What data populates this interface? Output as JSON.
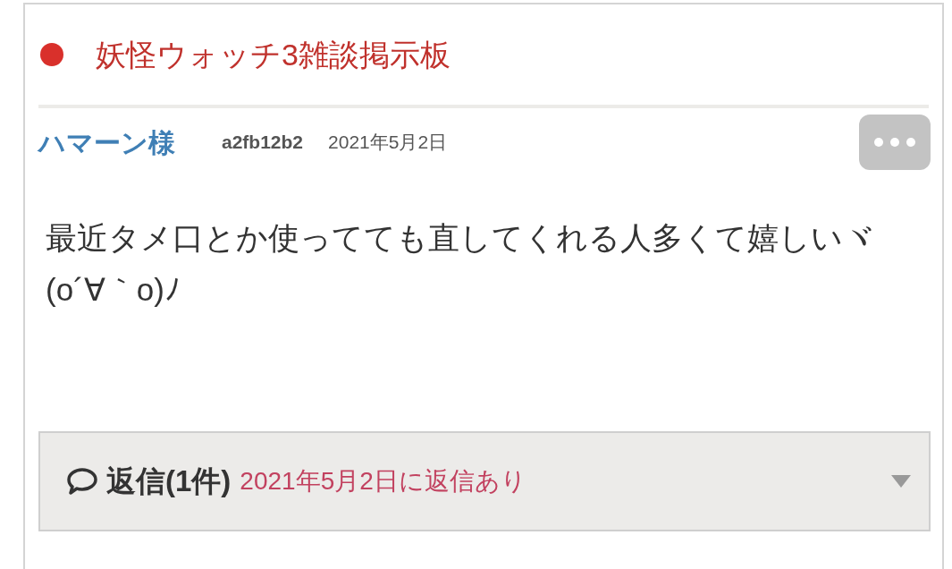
{
  "board": {
    "title": "妖怪ウォッチ3雑談掲示板",
    "color": "#d9302b"
  },
  "post": {
    "author": "ハマーン様",
    "id": "a2fb12b2",
    "date": "2021年5月2日",
    "body": "最近タメ口とか使ってても直してくれる人多くて嬉しいヾ(o´∀｀o)ﾉ"
  },
  "replies": {
    "label": "返信(1件)",
    "note": "2021年5月2日に返信あり",
    "expanded": false
  }
}
